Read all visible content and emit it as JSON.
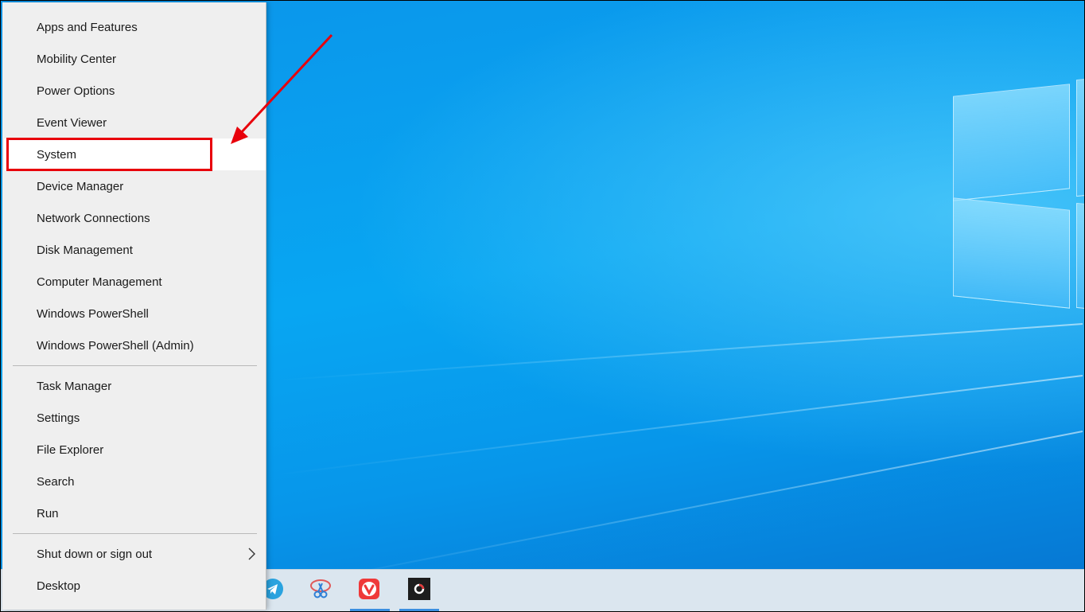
{
  "menu": {
    "items": [
      {
        "label": "Apps and Features"
      },
      {
        "label": "Mobility Center"
      },
      {
        "label": "Power Options"
      },
      {
        "label": "Event Viewer"
      },
      {
        "label": "System"
      },
      {
        "label": "Device Manager"
      },
      {
        "label": "Network Connections"
      },
      {
        "label": "Disk Management"
      },
      {
        "label": "Computer Management"
      },
      {
        "label": "Windows PowerShell"
      },
      {
        "label": "Windows PowerShell (Admin)"
      },
      {
        "label": "Task Manager"
      },
      {
        "label": "Settings"
      },
      {
        "label": "File Explorer"
      },
      {
        "label": "Search"
      },
      {
        "label": "Run"
      },
      {
        "label": "Shut down or sign out"
      },
      {
        "label": "Desktop"
      }
    ],
    "hovered_item": "System",
    "submenu_icon": "chevron-right-icon"
  },
  "annotation": {
    "color": "#e8000b"
  },
  "taskbar": {
    "icons": [
      "telegram-icon",
      "snipping-tool-icon",
      "vivaldi-icon",
      "app-icon"
    ]
  }
}
